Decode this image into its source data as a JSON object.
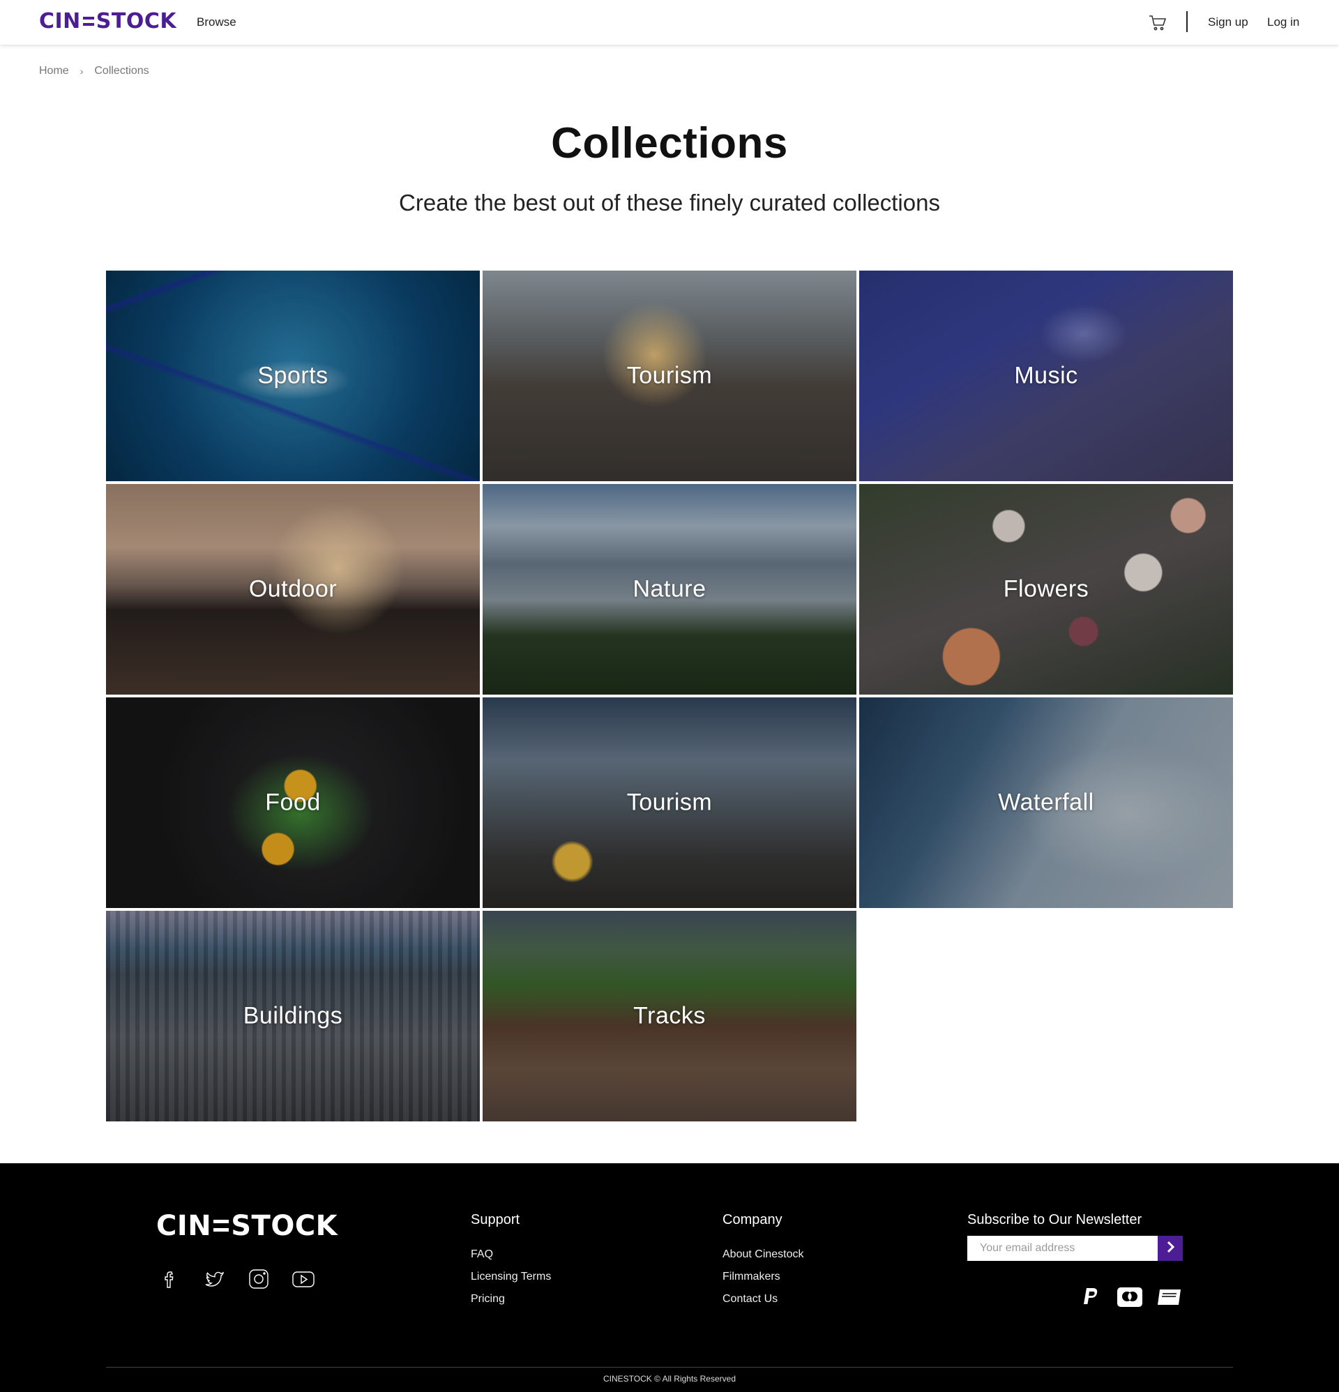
{
  "header": {
    "logo_text": "CINESTOCK",
    "browse_label": "Browse",
    "signup_label": "Sign up",
    "login_label": "Log in",
    "cart_icon": "cart-icon",
    "brand_color": "#4d1d95"
  },
  "breadcrumb": {
    "items": [
      "Home",
      "Collections"
    ]
  },
  "page": {
    "title": "Collections",
    "subtitle": "Create the best out of these finely curated collections"
  },
  "collections": [
    {
      "label": "Sports"
    },
    {
      "label": "Tourism"
    },
    {
      "label": "Music"
    },
    {
      "label": "Outdoor"
    },
    {
      "label": "Nature"
    },
    {
      "label": "Flowers"
    },
    {
      "label": "Food"
    },
    {
      "label": "Tourism"
    },
    {
      "label": "Waterfall"
    },
    {
      "label": "Buildings"
    },
    {
      "label": "Tracks"
    }
  ],
  "footer": {
    "logo_text": "CINESTOCK",
    "social_icons": [
      "facebook-icon",
      "twitter-icon",
      "instagram-icon",
      "youtube-icon"
    ],
    "support": {
      "title": "Support",
      "links": [
        "FAQ",
        "Licensing Terms",
        "Pricing"
      ]
    },
    "company": {
      "title": "Company",
      "links": [
        "About Cinestock",
        "Filmmakers",
        "Contact Us"
      ]
    },
    "newsletter": {
      "title": "Subscribe to Our Newsletter",
      "placeholder": "Your email address",
      "value": ""
    },
    "payment_icons": [
      "paypal-icon",
      "mastercard-icon",
      "unionpay-icon"
    ],
    "copyright": "CINESTOCK © All Rights Reserved"
  }
}
